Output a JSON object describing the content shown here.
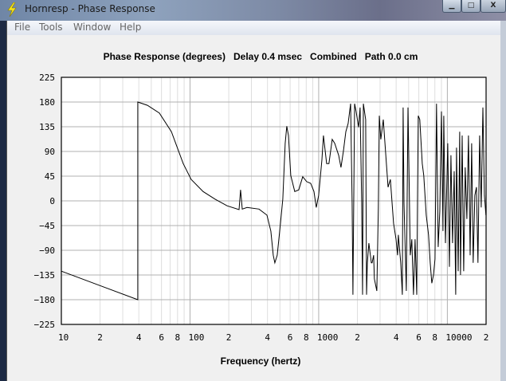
{
  "window": {
    "title": "Hornresp - Phase Response",
    "minimize": "▁",
    "maximize": "□",
    "close": "X"
  },
  "menu": [
    "File",
    "Tools",
    "Window",
    "Help"
  ],
  "chart_data": {
    "type": "line",
    "title": "Phase Response (degrees)   Delay 0.4 msec   Combined   Path 0.0 cm",
    "xlabel": "Frequency (hertz)",
    "ylabel": "",
    "xscale": "log",
    "xlim_hz": [
      10,
      20000
    ],
    "ylim": [
      -225,
      225
    ],
    "yticks": [
      225,
      180,
      135,
      90,
      45,
      0,
      -45,
      -90,
      -135,
      -180,
      -225
    ],
    "ytick_labels": [
      "225",
      "180",
      "135",
      "90",
      "45",
      "0",
      "−45",
      "−90",
      "−135",
      "−180",
      "−225"
    ],
    "xticks_hz": [
      10,
      20,
      40,
      60,
      80,
      100,
      200,
      400,
      600,
      800,
      1000,
      2000,
      4000,
      6000,
      8000,
      10000,
      20000
    ],
    "xtick_labels": [
      "10",
      "2",
      "4",
      "6",
      "8",
      "100",
      "2",
      "4",
      "6",
      "8",
      "1000",
      "2",
      "4",
      "6",
      "8",
      "10000",
      "2"
    ],
    "grid": true,
    "series": [
      {
        "name": "Phase",
        "color": "#000000",
        "x_log10_hz": [
          1.0,
          1.594,
          1.594,
          1.669,
          1.762,
          1.855,
          1.947,
          2.009,
          2.102,
          2.195,
          2.288,
          2.381,
          2.393,
          2.406,
          2.443,
          2.536,
          2.598,
          2.628,
          2.647,
          2.659,
          2.678,
          2.697,
          2.721,
          2.74,
          2.752,
          2.765,
          2.783,
          2.814,
          2.845,
          2.876,
          2.907,
          2.938,
          2.963,
          2.981,
          3.0,
          3.025,
          3.037,
          3.062,
          3.08,
          3.105,
          3.124,
          3.155,
          3.173,
          3.192,
          3.211,
          3.229,
          3.248,
          3.26,
          3.266,
          3.279,
          3.291,
          3.31,
          3.322,
          3.334,
          3.341,
          3.347,
          3.365,
          3.372,
          3.378,
          3.39,
          3.409,
          3.415,
          3.427,
          3.433,
          3.452,
          3.464,
          3.471,
          3.483,
          3.502,
          3.526,
          3.539,
          3.557,
          3.582,
          3.601,
          3.613,
          3.619,
          3.638,
          3.65,
          3.656,
          3.663,
          3.681,
          3.694,
          3.712,
          3.724,
          3.737,
          3.749,
          3.762,
          3.768,
          3.774,
          3.786,
          3.805,
          3.817,
          3.836,
          3.854,
          3.867,
          3.879,
          3.892,
          3.904,
          3.916,
          3.929,
          3.941,
          3.954,
          3.966,
          3.972,
          3.985,
          4.003,
          4.016,
          4.028,
          4.04,
          4.053,
          4.065,
          4.071,
          4.084,
          4.096,
          4.102,
          4.115,
          4.127,
          4.139,
          4.152,
          4.164,
          4.177,
          4.189,
          4.201,
          4.214,
          4.226,
          4.238,
          4.251,
          4.263,
          4.276,
          4.288,
          4.3
        ],
        "phase_deg": [
          -128,
          -180,
          180,
          174,
          160,
          126,
          68,
          39,
          17,
          3,
          -9,
          -16,
          20,
          -15,
          -12,
          -15,
          -26,
          -55,
          -99,
          -113,
          -99,
          -55,
          3,
          105,
          136,
          119,
          46,
          17,
          20,
          44,
          35,
          32,
          17,
          -12,
          10,
          75,
          119,
          68,
          68,
          112,
          105,
          83,
          61,
          90,
          126,
          141,
          177,
          -4,
          -171,
          177,
          163,
          134,
          170,
          -4,
          -171,
          177,
          148,
          -171,
          -113,
          -77,
          -113,
          -113,
          -99,
          -142,
          -164,
          -12,
          155,
          112,
          148,
          68,
          25,
          39,
          -41,
          -70,
          -99,
          -62,
          -113,
          -171,
          170,
          -4,
          -164,
          170,
          -99,
          -70,
          -171,
          -70,
          -171,
          -4,
          155,
          148,
          68,
          46,
          -26,
          -62,
          -113,
          -150,
          -135,
          -106,
          177,
          -84,
          -19,
          163,
          -55,
          155,
          -77,
          105,
          -120,
          83,
          -77,
          54,
          -171,
          97,
          -128,
          126,
          -135,
          119,
          -128,
          61,
          -33,
          119,
          -99,
          105,
          -113,
          10,
          25,
          -113,
          119,
          -12,
          170,
          10,
          -26
        ]
      }
    ]
  }
}
